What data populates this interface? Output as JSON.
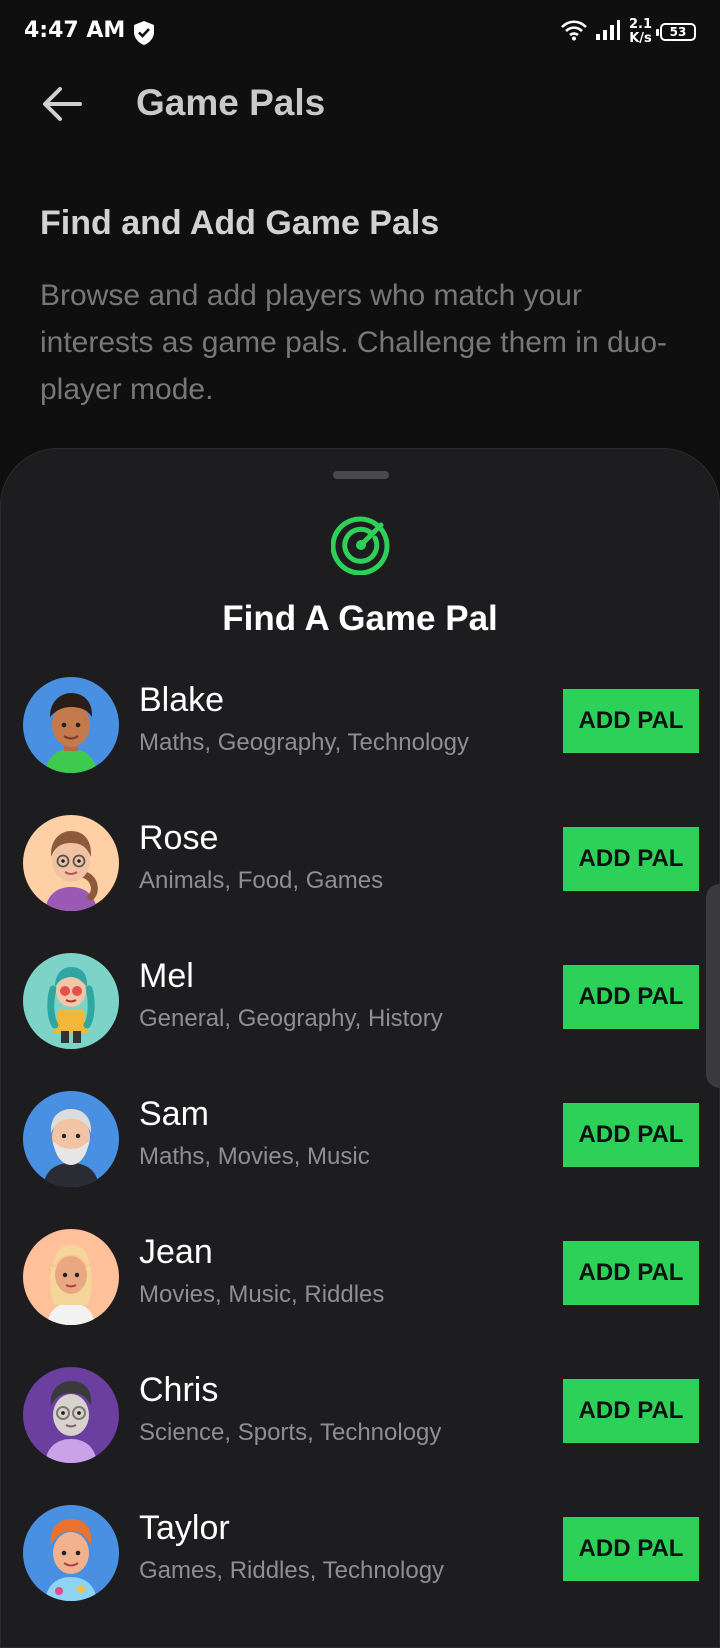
{
  "status_bar": {
    "time": "4:47 AM",
    "net_speed_value": "2.1",
    "net_speed_unit": "K/s",
    "battery": "53"
  },
  "header": {
    "title": "Game Pals"
  },
  "intro": {
    "heading": "Find and Add Game Pals",
    "description": "Browse and add players who match your interests as game pals. Challenge them in duo-player mode."
  },
  "sheet": {
    "title": "Find A Game Pal",
    "accent_color": "#2ed158",
    "pals": [
      {
        "name": "Blake",
        "interests": "Maths, Geography, Technology",
        "button": "ADD PAL",
        "avatar_bg": "#4a90e2"
      },
      {
        "name": "Rose",
        "interests": "Animals, Food, Games",
        "button": "ADD PAL",
        "avatar_bg": "#ffcfa6"
      },
      {
        "name": "Mel",
        "interests": "General, Geography, History",
        "button": "ADD PAL",
        "avatar_bg": "#7dd3c8"
      },
      {
        "name": "Sam",
        "interests": "Maths, Movies, Music",
        "button": "ADD PAL",
        "avatar_bg": "#4a90e2"
      },
      {
        "name": "Jean",
        "interests": "Movies, Music, Riddles",
        "button": "ADD PAL",
        "avatar_bg": "#ffc09a"
      },
      {
        "name": "Chris",
        "interests": "Science, Sports, Technology",
        "button": "ADD PAL",
        "avatar_bg": "#6b3fa0"
      },
      {
        "name": "Taylor",
        "interests": "Games, Riddles, Technology",
        "button": "ADD PAL",
        "avatar_bg": "#4a90e2"
      }
    ]
  }
}
